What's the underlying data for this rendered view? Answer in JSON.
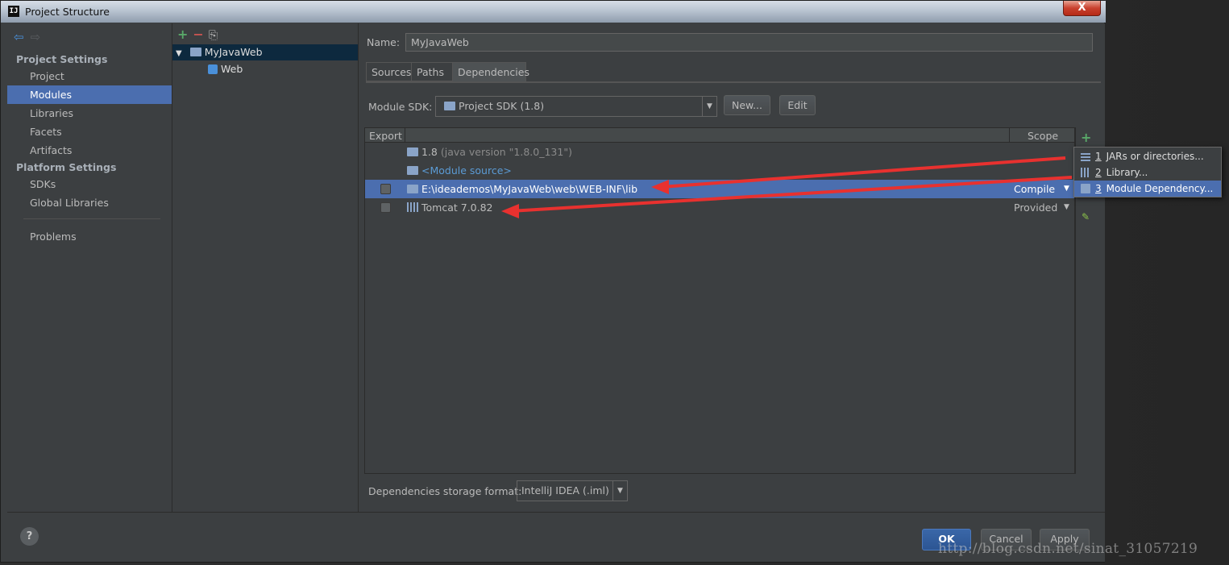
{
  "window": {
    "title": "Project Structure",
    "app_icon": "IJ",
    "close_label": "X"
  },
  "left_nav": {
    "back_icon": "back-arrow-icon",
    "forward_icon": "forward-arrow-icon",
    "project_settings_title": "Project Settings",
    "project_items": [
      "Project",
      "Modules",
      "Libraries",
      "Facets",
      "Artifacts"
    ],
    "selected": "Modules",
    "platform_settings_title": "Platform Settings",
    "platform_items": [
      "SDKs",
      "Global Libraries"
    ],
    "problems": "Problems"
  },
  "module_tree": {
    "toolbar": {
      "add": "+",
      "remove": "−",
      "copy": "⎘"
    },
    "root": "MyJavaWeb",
    "child": "Web"
  },
  "content": {
    "name_label": "Name:",
    "name_value": "MyJavaWeb",
    "tabs": [
      "Sources",
      "Paths",
      "Dependencies"
    ],
    "active_tab": "Dependencies",
    "sdk_label": "Module SDK:",
    "sdk_value": "Project SDK (1.8)",
    "new_button": "New...",
    "edit_button": "Edit",
    "table": {
      "col_export": "Export",
      "col_scope": "Scope",
      "rows": [
        {
          "name": "1.8",
          "detail": " (java version \"1.8.0_131\")",
          "scope": "",
          "checkbox": false
        },
        {
          "name": "<Module source>",
          "detail": "",
          "scope": "",
          "checkbox": false
        },
        {
          "name": "E:\\ideademos\\MyJavaWeb\\web\\WEB-INF\\lib",
          "detail": "",
          "scope": "Compile",
          "checkbox": true,
          "selected": true
        },
        {
          "name": "Tomcat 7.0.82",
          "detail": "",
          "scope": "Provided",
          "checkbox": true
        }
      ]
    },
    "popup": [
      {
        "num": "1",
        "label": "JARs or directories..."
      },
      {
        "num": "2",
        "label": "Library..."
      },
      {
        "num": "3",
        "label": "Module Dependency...",
        "selected": true
      }
    ],
    "storage_label": "Dependencies storage format:",
    "storage_value": "IntelliJ IDEA (.iml)"
  },
  "footer": {
    "help": "?",
    "ok": "OK",
    "cancel": "Cancel",
    "apply": "Apply"
  },
  "watermark": "http://blog.csdn.net/sinat_31057219",
  "colors": {
    "selection": "#4b6eaf",
    "annotation_arrow": "#e8312f",
    "add_green": "#59a869"
  }
}
